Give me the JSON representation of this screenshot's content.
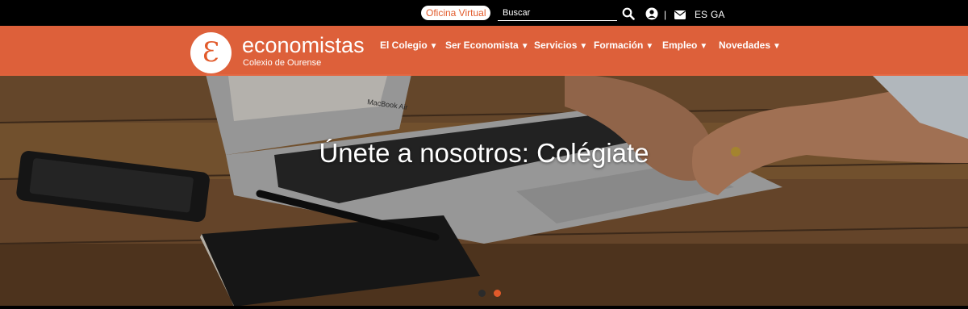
{
  "topbar": {
    "oficina_label": "Oficina Virtual",
    "search_placeholder": "Buscar",
    "separator": "|",
    "lang_es": "ES",
    "lang_ga": "GA",
    "icons": [
      "search-icon",
      "user-icon",
      "mail-icon"
    ]
  },
  "brand": {
    "logo_glyph": "Ɛ",
    "name": "economistas",
    "subtitle": "Colexio de Ourense"
  },
  "nav": {
    "caret": "▼",
    "items": [
      {
        "label": "El Colegio"
      },
      {
        "label": "Ser Economista"
      },
      {
        "label": "Servicios"
      },
      {
        "label": "Formación"
      },
      {
        "label": "Empleo"
      },
      {
        "label": "Novedades"
      }
    ]
  },
  "hero": {
    "title": "Únete a nosotros: Colégiate",
    "laptop_brand": "MacBook Air",
    "slides": 2,
    "active_slide": 2
  },
  "colors": {
    "accent": "#e25a2a",
    "navbar": "#e8643c",
    "topbar": "#000000"
  }
}
